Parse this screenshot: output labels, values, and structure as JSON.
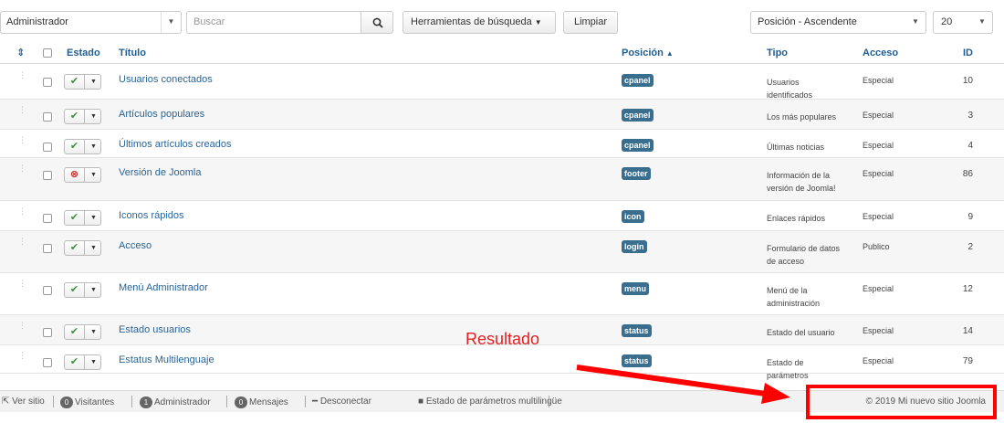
{
  "toolbar": {
    "client": "Administrador",
    "search_placeholder": "Buscar",
    "search_tools": "Herramientas de búsqueda",
    "clear": "Limpiar",
    "ordering": "Posición - Ascendente",
    "limit": "20"
  },
  "table": {
    "headers": {
      "status": "Estado",
      "title": "Título",
      "position": "Posición",
      "type": "Tipo",
      "access": "Acceso",
      "id": "ID"
    },
    "rows": [
      {
        "status": "published",
        "title": "Usuarios conectados",
        "position": "cpanel",
        "type": "Usuarios identificados",
        "access": "Especial",
        "id": "10"
      },
      {
        "status": "published",
        "title": "Artículos populares",
        "position": "cpanel",
        "type": "Los más populares",
        "access": "Especial",
        "id": "3"
      },
      {
        "status": "published",
        "title": "Últimos artículos creados",
        "position": "cpanel",
        "type": "Últimas noticias",
        "access": "Especial",
        "id": "4"
      },
      {
        "status": "unpublished",
        "title": "Versión de Joomla",
        "position": "footer",
        "type": "Información de la versión de Joomla!",
        "access": "Especial",
        "id": "86"
      },
      {
        "status": "published",
        "title": "Iconos rápidos",
        "position": "icon",
        "type": "Enlaces rápidos",
        "access": "Especial",
        "id": "9"
      },
      {
        "status": "published",
        "title": "Acceso",
        "position": "login",
        "type": "Formulario de datos de acceso",
        "access": "Publico",
        "id": "2"
      },
      {
        "status": "published",
        "title": "Menú Administrador",
        "position": "menu",
        "type": "Menú de la administración",
        "access": "Especial",
        "id": "12"
      },
      {
        "status": "published",
        "title": "Estado usuarios",
        "position": "status",
        "type": "Estado del usuario",
        "access": "Especial",
        "id": "14"
      },
      {
        "status": "published",
        "title": "Estatus Multilenguaje",
        "position": "status",
        "type": "Estado de parámetros",
        "access": "Especial",
        "id": "79"
      }
    ]
  },
  "footer": {
    "view_site": "Ver sitio",
    "visitors_count": "0",
    "visitors": "Visitantes",
    "admins_count": "1",
    "admins": "Administrador",
    "messages_count": "0",
    "messages": "Mensajes",
    "logout": "Desconectar",
    "multilang": "Estado de parámetros multilingüe",
    "copyright": "© 2019 Mi nuevo sitio Joomla"
  },
  "annotation": {
    "label": "Resultado",
    "color": "#ff0000"
  }
}
